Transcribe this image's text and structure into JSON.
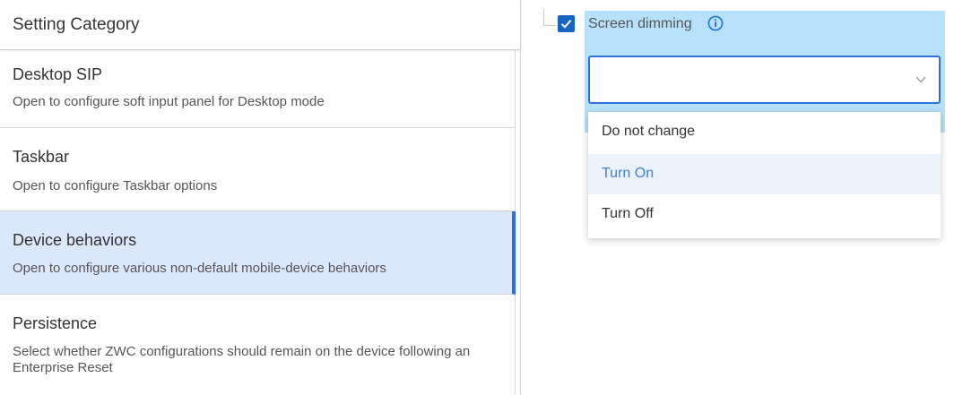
{
  "category_header": "Setting Category",
  "categories": [
    {
      "title": "Desktop SIP",
      "description": "Open to configure soft input panel for Desktop mode"
    },
    {
      "title": "Taskbar",
      "description": "Open to configure Taskbar options"
    },
    {
      "title": "Device behaviors",
      "description": "Open to configure various non-default mobile-device behaviors",
      "selected": true
    },
    {
      "title": "Persistence",
      "description": "Select whether ZWC configurations should remain on the device following an Enterprise Reset"
    }
  ],
  "setting": {
    "label": "Screen dimming",
    "checked": true,
    "value": "",
    "options": [
      "Do not change",
      "Turn On",
      "Turn Off"
    ],
    "highlighted_option": "Turn On"
  },
  "colors": {
    "accent": "#2f6fe0",
    "selected_bg": "#dbe8fb",
    "setting_bg": "#b7e1fb",
    "checkbox": "#1565c0"
  },
  "icons": {
    "info": "info-icon",
    "chevron": "chevron-down-icon",
    "check": "check-icon"
  }
}
